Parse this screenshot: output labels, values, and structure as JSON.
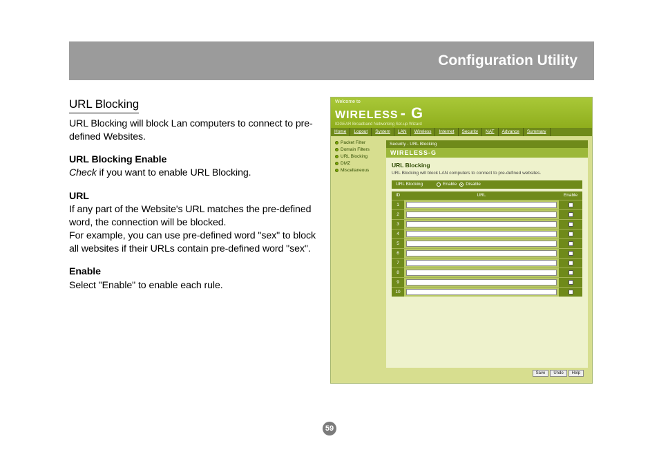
{
  "page_number": "59",
  "header_title": "Configuration Utility",
  "doc": {
    "section_title": "URL Blocking",
    "intro": "URL Blocking will block Lan computers to connect to pre-defined Websites.",
    "h1": "URL Blocking Enable",
    "p1_italic": "Check",
    "p1_rest": " if you want to enable URL Blocking.",
    "h2": "URL",
    "p2a": "If any part of the Website's URL matches the pre-defined word, the connection will be blocked.",
    "p2b": "For example, you can use pre-defined word \"sex\" to block all websites if their URLs contain pre-defined word \"sex\".",
    "h3": "Enable",
    "p3": "Select \"Enable\" to enable each rule."
  },
  "screenshot": {
    "welcome": "Welcome to",
    "brand": "WIRELESS",
    "brand_suffix": "- G",
    "subtitle": "IOGEAR Broadband Networking Set-up Wizard",
    "nav": [
      "Home",
      "Logout",
      "System",
      "LAN",
      "Wireless",
      "Internet",
      "Security",
      "NAT",
      "Advance",
      "Summary"
    ],
    "sidebar": [
      "Packet Filter",
      "Domain Filters",
      "URL Blocking",
      "DMZ",
      "Miscellaneous"
    ],
    "breadcrumb": "Security - URL Blocking",
    "panel_brand": "WIRELESS-G",
    "panel_title": "URL Blocking",
    "panel_desc": "URL Blocking will block LAN computers to connect to pre-defined websites.",
    "toggle_label": "URL Blocking",
    "toggle_enable": "Enable",
    "toggle_disable": "Disable",
    "toggle_selected": "Disable",
    "table": {
      "headers": {
        "id": "ID",
        "url": "URL",
        "enable": "Enable"
      },
      "rows": [
        {
          "id": "1",
          "url": "",
          "enable": false
        },
        {
          "id": "2",
          "url": "",
          "enable": false
        },
        {
          "id": "3",
          "url": "",
          "enable": false
        },
        {
          "id": "4",
          "url": "",
          "enable": false
        },
        {
          "id": "5",
          "url": "",
          "enable": false
        },
        {
          "id": "6",
          "url": "",
          "enable": false
        },
        {
          "id": "7",
          "url": "",
          "enable": false
        },
        {
          "id": "8",
          "url": "",
          "enable": false
        },
        {
          "id": "9",
          "url": "",
          "enable": false
        },
        {
          "id": "10",
          "url": "",
          "enable": false
        }
      ]
    },
    "buttons": {
      "save": "Save",
      "undo": "Undo",
      "help": "Help"
    }
  }
}
